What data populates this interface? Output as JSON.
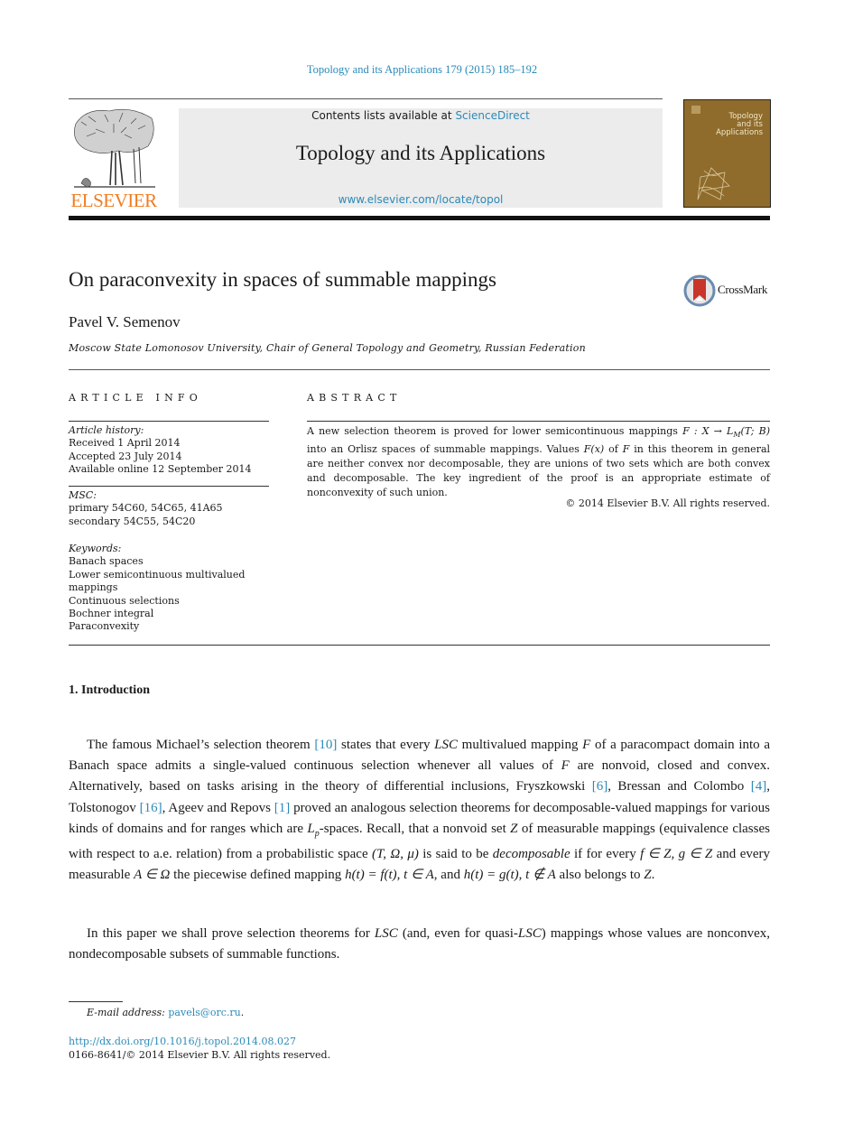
{
  "header": {
    "journal_reference": "Topology and its Applications 179 (2015) 185–192",
    "contents_prefix": "Contents lists available at ",
    "contents_link": "ScienceDirect",
    "journal_title": "Topology and its Applications",
    "journal_url": "www.elsevier.com/locate/topol",
    "publisher_wordmark": "ELSEVIER",
    "cover_title": "Topology\nand its\nApplications",
    "colors": {
      "link": "#2b8ab8",
      "elsevier_orange": "#f07c20",
      "cover": "#8f6c2c"
    }
  },
  "article": {
    "title": "On paraconvexity in spaces of summable mappings",
    "crossmark_label": "CrossMark",
    "author": "Pavel V. Semenov",
    "affiliation": "Moscow State Lomonosov University, Chair of General Topology and Geometry, Russian Federation"
  },
  "article_info": {
    "heading": "ARTICLE INFO",
    "history_label": "Article history:",
    "history": [
      "Received 1 April 2014",
      "Accepted 23 July 2014",
      "Available online 12 September 2014"
    ],
    "msc_label": "MSC:",
    "msc": [
      "primary 54C60, 54C65, 41A65",
      "secondary 54C55, 54C20"
    ],
    "keywords_label": "Keywords:",
    "keywords": [
      "Banach spaces",
      "Lower semicontinuous multivalued mappings",
      "Continuous selections",
      "Bochner integral",
      "Paraconvexity"
    ]
  },
  "abstract": {
    "heading": "ABSTRACT",
    "text_1": "A new selection theorem is proved for lower semicontinuous mappings ",
    "math_1": "F : X → L",
    "math_1_sub": "M",
    "math_1b": "(T; B)",
    "text_2": " into an Orlisz spaces of summable mappings. Values ",
    "math_2": "F(x)",
    "text_3": " of ",
    "math_3": "F",
    "text_4": " in this theorem in general are neither convex nor decomposable, they are unions of two sets which are both convex and decomposable. The key ingredient of the proof is an appropriate estimate of nonconvexity of such union.",
    "copyright": "© 2014 Elsevier B.V. All rights reserved."
  },
  "section": {
    "heading": "1.  Introduction",
    "para1": {
      "t1": "The famous Michael’s selection theorem ",
      "ref_10": "[10]",
      "t2": " states that every ",
      "lsc": "LSC",
      "t3": " multivalued mapping ",
      "F": "F",
      "t4": " of a para­compact domain into a Banach space admits a single-valued continuous selection whenever all values of ",
      "t5": " are nonvoid, closed and convex. Alternatively, based on tasks arising in the theory of differential inclusions, Fryszkowski ",
      "ref_6": "[6]",
      "t6": ", Bressan and Colombo ",
      "ref_4": "[4]",
      "t7": ", Tolstonogov ",
      "ref_16": "[16]",
      "t8": ", Ageev and Repovs ",
      "ref_1": "[1]",
      "t9": " proved an analogous selection theorems for decomposable-valued mappings for various kinds of domains and for ranges which are ",
      "Lp": "L",
      "Lp_sub": "p",
      "t10": "-spaces. Recall, that a nonvoid set ",
      "Z": "Z",
      "t11": " of measurable mappings (equivalence classes with respect to a.e. relation) from a probabilistic space ",
      "space": "(T, Ω, μ)",
      "t12": " is said to be ",
      "decomposable": "decomposable",
      "t13": " if for every ",
      "m1": "f ∈ Z, g ∈ Z",
      "t14": " and every measurable ",
      "m2": "A ∈ Ω",
      "t15": " the piecewise defined mapping ",
      "m3": "h(t) = f(t), t ∈ A",
      "t16": ", and ",
      "m4": "h(t) = g(t), t ∉ A",
      "t17": " also belongs to ",
      "t18": "."
    },
    "para2": {
      "t1": "In this paper we shall prove selection theorems for ",
      "lsc": "LSC",
      "t2": " (and, even for quasi-",
      "t3": ") mappings whose values are nonconvex, nondecomposable subsets of summable functions."
    }
  },
  "footer": {
    "email_label": "E-mail address:",
    "email": "pavels@orc.ru",
    "email_suffix": ".",
    "doi": "http://dx.doi.org/10.1016/j.topol.2014.08.027",
    "issn_copyright": "0166-8641/© 2014 Elsevier B.V. All rights reserved."
  }
}
